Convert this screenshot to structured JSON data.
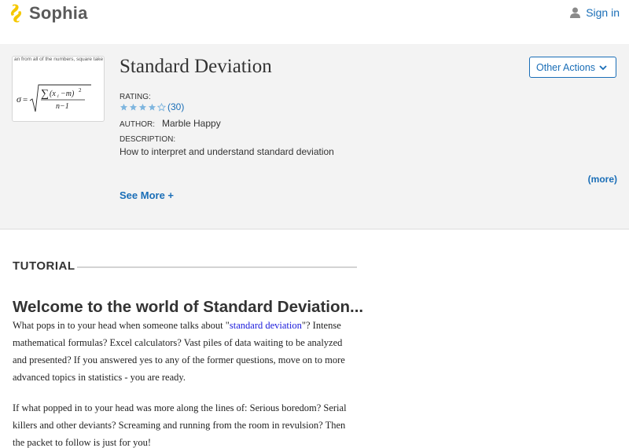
{
  "header": {
    "logo_text": "Sophia",
    "signin_label": "Sign in"
  },
  "hero": {
    "thumbnail_text": "an from all of the numbers, square take the square-root; in short we",
    "title": "Standard Deviation",
    "rating_label": "RATING:",
    "rating_stars": 4,
    "rating_max": 5,
    "rating_count": "(30)",
    "author_label": "AUTHOR:",
    "author_value": "Marble Happy",
    "description_label": "DESCRIPTION:",
    "description_value": "How to interpret and understand standard deviation",
    "more_label": "(more)",
    "see_more_label": "See More +",
    "other_actions_label": "Other Actions"
  },
  "tutorial": {
    "section_label": "TUTORIAL",
    "heading": "Welcome to the world of Standard Deviation...",
    "p1_before": "What pops in to your head when someone talks about \"",
    "p1_link": "standard deviation",
    "p1_after": "\"?  Intense mathematical formulas?  Excel calculators?  Vast piles of data waiting to be analyzed and presented?  If you answered yes to any of the former questions, move on to more advanced topics in statistics - you are ready.",
    "p2": "If what popped in to your head was more along the lines of:  Serious boredom?  Serial killers and other deviants? Screaming and running from the room in revulsion?  Then the packet to follow is just for you!"
  },
  "colors": {
    "link": "#1a6eb7",
    "star": "#7fb6df",
    "logo_yellow": "#f5c800"
  }
}
